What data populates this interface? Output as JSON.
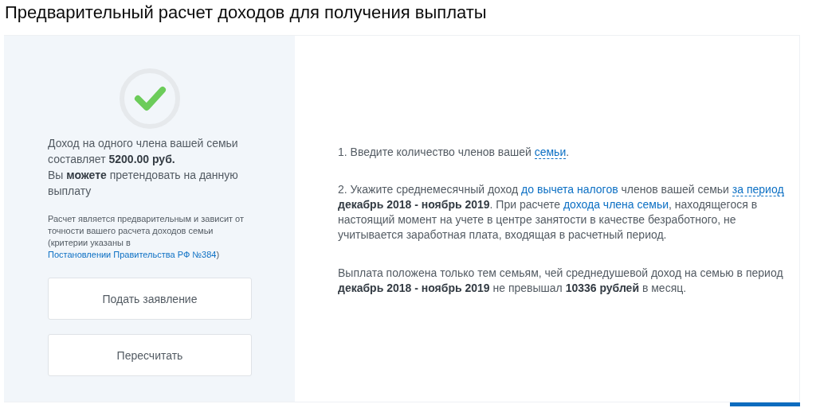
{
  "title": "Предварительный расчет доходов для получения выплаты",
  "result": {
    "success": true,
    "income_text": [
      {
        "kind": "plain",
        "text": "Доход на одного члена вашей семьи составляет "
      },
      {
        "kind": "bold",
        "text": "5200.00 руб."
      }
    ],
    "eligibility_text": [
      {
        "kind": "plain",
        "text": "Вы "
      },
      {
        "kind": "bold",
        "text": "можете"
      },
      {
        "kind": "plain",
        "text": " претендовать на данную выплату"
      }
    ],
    "note": [
      {
        "kind": "plain",
        "text": "Расчет является предварительным и зависит от точности вашего расчета доходов семьи (критерии указаны в "
      },
      {
        "kind": "link",
        "text": "Постановлении "
      },
      {
        "kind": "link",
        "text": "Правительства РФ №384"
      },
      {
        "kind": "plain",
        "text": ")"
      }
    ]
  },
  "buttons": [
    "Подать заявление",
    "Пересчитать"
  ],
  "instructions": [
    [
      {
        "kind": "plain",
        "text": "1. Введите количество членов вашей "
      },
      {
        "kind": "dotted-link",
        "text": "семьи"
      },
      {
        "kind": "plain",
        "text": "."
      }
    ],
    [
      {
        "kind": "plain",
        "text": "2. Укажите среднемесячный доход "
      },
      {
        "kind": "link",
        "text": "до вычета налогов"
      },
      {
        "kind": "plain",
        "text": " членов вашей семьи "
      },
      {
        "kind": "dotted-link",
        "text": "за период"
      },
      {
        "kind": "bold",
        "text": " декабрь 2018 - ноябрь 2019"
      },
      {
        "kind": "plain",
        "text": ". При расчете "
      },
      {
        "kind": "link",
        "text": "дохода члена семьи"
      },
      {
        "kind": "plain",
        "text": ", находящегося в настоящий момент на учете в центре занятости в качестве безработного, не учитывается заработная плата, входящая в расчетный период."
      }
    ],
    [
      {
        "kind": "plain",
        "text": "Выплата положена только тем семьям, чей среднедушевой доход на семью в период "
      },
      {
        "kind": "bold",
        "text": "декабрь 2018 - ноябрь 2019"
      },
      {
        "kind": "plain",
        "text": " не превышал "
      },
      {
        "kind": "bold",
        "text": "10336 рублей"
      },
      {
        "kind": "plain",
        "text": " в месяц."
      }
    ]
  ]
}
